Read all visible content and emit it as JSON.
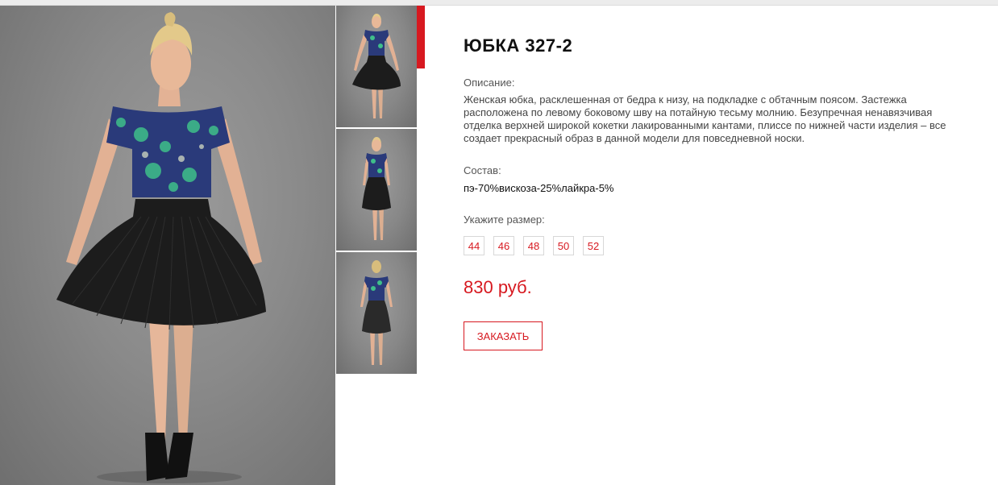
{
  "product": {
    "title": "ЮБКА 327-2",
    "description_label": "Описание:",
    "description": "Женская юбка, расклешенная от бедра к низу, на подкладке с обтачным поясом. Застежка расположена по левому боковому шву на потайную тесьму молнию. Безупречная ненавязчивая отделка верхней широкой кокетки лакированными кантами, плиссе по нижней части изделия – все создает прекрасный образ в данной модели для повседневной носки.",
    "composition_label": "Состав:",
    "composition": "пэ-70%вискоза-25%лайкра-5%",
    "size_label": "Укажите размер:",
    "sizes": [
      "44",
      "46",
      "48",
      "50",
      "52"
    ],
    "price": "830 руб.",
    "order_label": "ЗАКАЗАТЬ"
  },
  "gallery": {
    "thumbnails": [
      "front view",
      "side view",
      "back view"
    ],
    "active_thumbnail": 0
  },
  "colors": {
    "accent": "#d71920",
    "photo_background": "#8a8a8a",
    "skirt": "#1a1a1a",
    "top_print": "#2a3a7a"
  }
}
